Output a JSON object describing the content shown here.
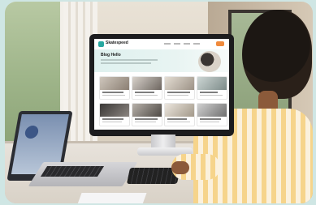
{
  "scene": {
    "description_none": "",
    "screen_site": {
      "logo_text": "Skatespeed",
      "hero_title": "Blog Hello"
    }
  },
  "colors": {
    "frame_bg": "#cfe6e4",
    "brand_accent": "#27a7a0",
    "cta": "#f08a3c",
    "shirt_stripe": "#f6d48b"
  }
}
